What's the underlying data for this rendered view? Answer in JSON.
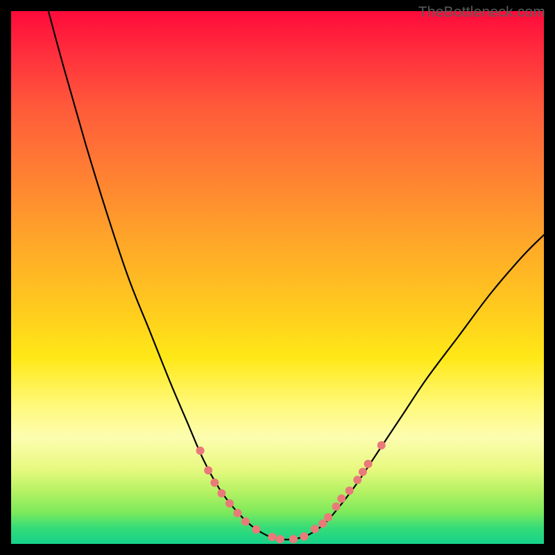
{
  "watermark": "TheBottleneck.com",
  "chart_data": {
    "type": "line",
    "title": "",
    "xlabel": "",
    "ylabel": "",
    "xlim": [
      0,
      100
    ],
    "ylim": [
      0,
      100
    ],
    "grid": false,
    "legend": false,
    "series": [
      {
        "name": "bottleneck-curve",
        "stroke": "#000000",
        "points": [
          {
            "x": 7.0,
            "y": 100.0
          },
          {
            "x": 10.0,
            "y": 89.0
          },
          {
            "x": 14.0,
            "y": 75.0
          },
          {
            "x": 18.0,
            "y": 62.0
          },
          {
            "x": 22.0,
            "y": 50.0
          },
          {
            "x": 26.0,
            "y": 40.0
          },
          {
            "x": 30.0,
            "y": 30.0
          },
          {
            "x": 33.0,
            "y": 23.0
          },
          {
            "x": 36.0,
            "y": 16.0
          },
          {
            "x": 39.0,
            "y": 10.5
          },
          {
            "x": 42.0,
            "y": 6.5
          },
          {
            "x": 45.0,
            "y": 3.5
          },
          {
            "x": 48.0,
            "y": 1.6
          },
          {
            "x": 50.5,
            "y": 0.9
          },
          {
            "x": 53.0,
            "y": 0.9
          },
          {
            "x": 56.0,
            "y": 1.8
          },
          {
            "x": 59.0,
            "y": 4.0
          },
          {
            "x": 62.0,
            "y": 7.5
          },
          {
            "x": 65.0,
            "y": 11.5
          },
          {
            "x": 69.0,
            "y": 17.5
          },
          {
            "x": 73.0,
            "y": 23.5
          },
          {
            "x": 78.0,
            "y": 31.0
          },
          {
            "x": 84.0,
            "y": 39.0
          },
          {
            "x": 90.0,
            "y": 47.0
          },
          {
            "x": 96.0,
            "y": 54.0
          },
          {
            "x": 100.0,
            "y": 58.0
          }
        ]
      }
    ],
    "markers": {
      "name": "highlight-dots",
      "fill": "#ea7a7a",
      "radius": 6,
      "points": [
        {
          "x": 35.5,
          "y": 17.5
        },
        {
          "x": 37.0,
          "y": 13.8
        },
        {
          "x": 38.2,
          "y": 11.5
        },
        {
          "x": 39.5,
          "y": 9.5
        },
        {
          "x": 41.0,
          "y": 7.6
        },
        {
          "x": 42.5,
          "y": 5.8
        },
        {
          "x": 44.0,
          "y": 4.2
        },
        {
          "x": 46.0,
          "y": 2.7
        },
        {
          "x": 49.0,
          "y": 1.3
        },
        {
          "x": 50.5,
          "y": 0.9
        },
        {
          "x": 53.0,
          "y": 0.9
        },
        {
          "x": 55.0,
          "y": 1.4
        },
        {
          "x": 57.0,
          "y": 2.8
        },
        {
          "x": 58.5,
          "y": 3.8
        },
        {
          "x": 59.5,
          "y": 5.0
        },
        {
          "x": 61.0,
          "y": 7.0
        },
        {
          "x": 62.0,
          "y": 8.5
        },
        {
          "x": 63.5,
          "y": 10.0
        },
        {
          "x": 65.0,
          "y": 12.0
        },
        {
          "x": 66.0,
          "y": 13.5
        },
        {
          "x": 67.0,
          "y": 15.0
        },
        {
          "x": 69.5,
          "y": 18.5
        }
      ]
    }
  }
}
